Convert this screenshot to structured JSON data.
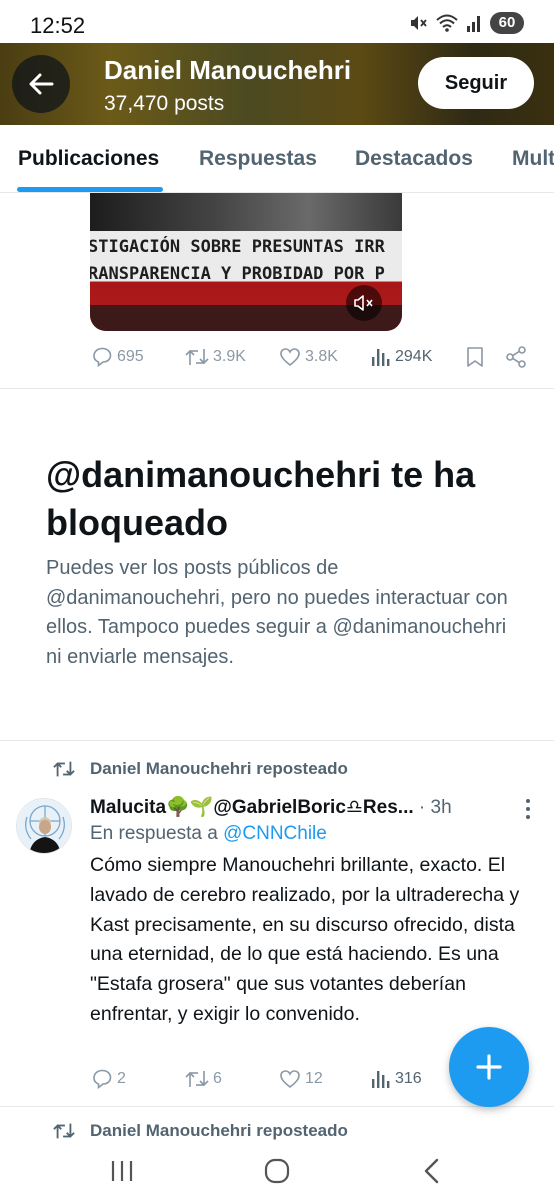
{
  "status_bar": {
    "time": "12:52",
    "battery": "60"
  },
  "header": {
    "name": "Daniel Manouchehri",
    "posts": "37,470 posts",
    "follow_label": "Seguir",
    "banner_color": "#5a4a16"
  },
  "tabs": [
    {
      "label": "Publicaciones",
      "active": true
    },
    {
      "label": "Respuestas",
      "active": false
    },
    {
      "label": "Destacados",
      "active": false
    },
    {
      "label": "Mult",
      "active": false
    }
  ],
  "video": {
    "line1": "STIGACIÓN SOBRE PRESUNTAS IRR",
    "line2": "RANSPARENCIA Y PROBIDAD POR P",
    "mute_icon": "volume-mute-icon"
  },
  "tweet1_actions": {
    "replies": "695",
    "reposts": "3.9K",
    "likes": "3.8K",
    "views": "294K"
  },
  "blocked": {
    "title": "@danimanouchehri te ha bloqueado",
    "description": "Puedes ver los posts públicos de @danimanouchehri, pero no puedes interactuar con ellos. Tampoco puedes seguir a @danimanouchehri ni enviarle mensajes."
  },
  "tweet2": {
    "repost_label": "Daniel Manouchehri reposteado",
    "author": "Malucita🌳🌱@GabrielBoric♎Res...",
    "time": "· 3h",
    "reply_prefix": "En respuesta a",
    "reply_handle": "@CNNChile",
    "text": "Cómo siempre Manouchehri brillante, exacto. El lavado de cerebro realizado, por la ultraderecha y Kast precisamente, en su discurso ofrecido, dista una eternidad, de lo que está haciendo. Es una \"Estafa grosera\" que sus votantes deberían enfrentar, y exigir lo convenido.",
    "replies": "2",
    "reposts": "6",
    "likes": "12",
    "views": "316"
  },
  "tweet3": {
    "repost_label": "Daniel Manouchehri reposteado"
  },
  "colors": {
    "accent": "#1d9bf0",
    "secondary_text": "#536471"
  }
}
